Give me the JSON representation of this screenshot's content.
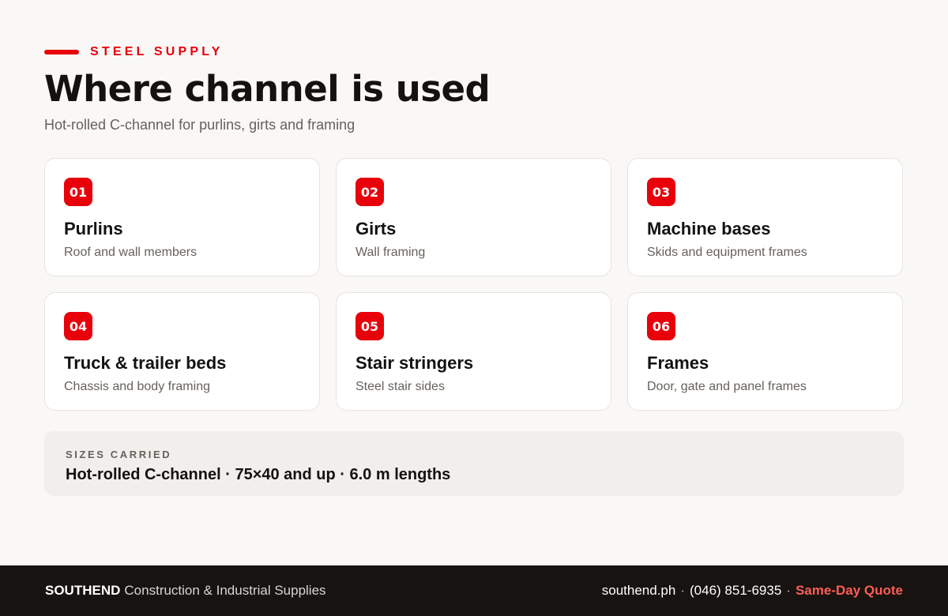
{
  "header": {
    "eyebrow": "STEEL SUPPLY",
    "title": "Where channel is used",
    "subtitle": "Hot-rolled C-channel for purlins, girts and framing"
  },
  "uses": [
    {
      "number": "01",
      "title": "Purlins",
      "description": "Roof and wall members"
    },
    {
      "number": "02",
      "title": "Girts",
      "description": "Wall framing"
    },
    {
      "number": "03",
      "title": "Machine bases",
      "description": "Skids and equipment frames"
    },
    {
      "number": "04",
      "title": "Truck & trailer beds",
      "description": "Chassis and body framing"
    },
    {
      "number": "05",
      "title": "Stair stringers",
      "description": "Steel stair sides"
    },
    {
      "number": "06",
      "title": "Frames",
      "description": "Door, gate and panel frames"
    }
  ],
  "sizes": {
    "label": "SIZES CARRIED",
    "value": "Hot-rolled C-channel · 75×40 and up · 6.0 m lengths"
  },
  "footer": {
    "brand": "SOUTHEND",
    "tagline": "Construction & Industrial Supplies",
    "website": "southend.ph",
    "separator": "·",
    "phone": "(046) 851-6935",
    "cta": "Same-Day Quote"
  },
  "colors": {
    "accent": "#e8000b",
    "background": "#f9f8f6",
    "footer_bg": "#161310",
    "cta": "#ff5d55"
  }
}
